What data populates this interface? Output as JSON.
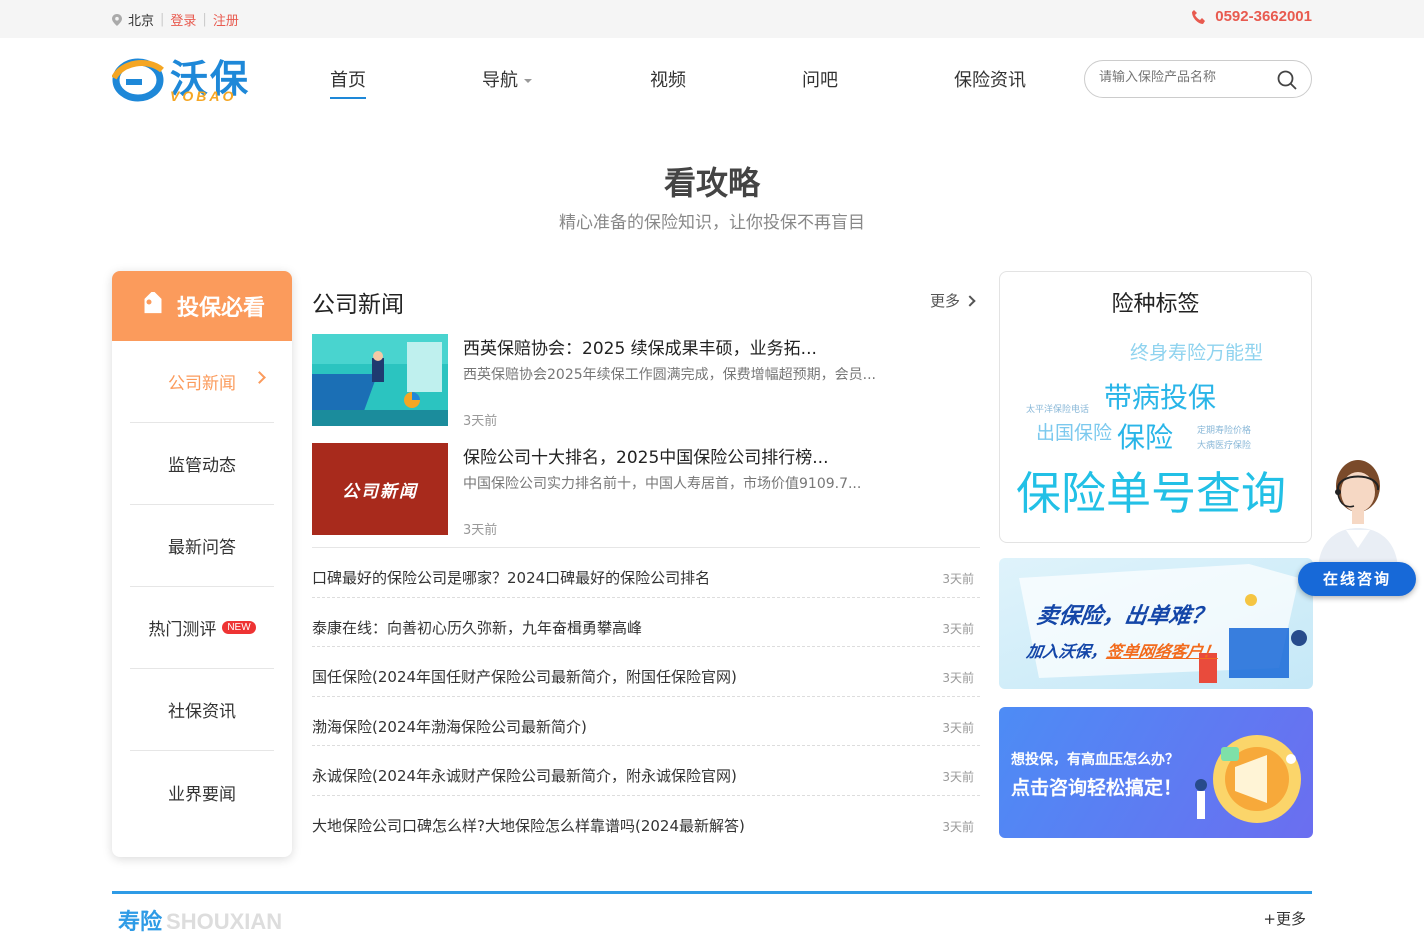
{
  "topbar": {
    "city": "北京",
    "login": "登录",
    "register": "注册",
    "phone": "0592-3662001"
  },
  "logo": {
    "cn": "沃保",
    "en": "VOBAO"
  },
  "nav": [
    {
      "label": "首页",
      "active": true
    },
    {
      "label": "导航"
    },
    {
      "label": "视频"
    },
    {
      "label": "问吧"
    },
    {
      "label": "保险资讯"
    }
  ],
  "search": {
    "placeholder": "请输入保险产品名称"
  },
  "section": {
    "title": "看攻略",
    "subtitle": "精心准备的保险知识，让你投保不再盲目"
  },
  "sidebar": {
    "head": "投保必看",
    "items": [
      {
        "label": "公司新闻"
      },
      {
        "label": "监管动态"
      },
      {
        "label": "最新问答"
      },
      {
        "label": "热门测评",
        "badge": "NEW"
      },
      {
        "label": "社保资讯"
      },
      {
        "label": "业界要闻"
      }
    ]
  },
  "news": {
    "heading": "公司新闻",
    "more": "更多",
    "featured": [
      {
        "title": "西英保赔协会：2025 续保成果丰硕，业务拓...",
        "desc": "西英保赔协会2025年续保工作圆满完成，保费增幅超预期，会员...",
        "time": "3天前"
      },
      {
        "title": "保险公司十大排名，2025中国保险公司排行榜...",
        "desc": "中国保险公司实力排名前十，中国人寿居首，市场价值9109.7...",
        "time": "3天前",
        "thumb_text": "公司新闻"
      }
    ],
    "list": [
      {
        "title": "口碑最好的保险公司是哪家？2024口碑最好的保险公司排名",
        "time": "3天前"
      },
      {
        "title": "泰康在线：向善初心历久弥新，九年奋楫勇攀高峰",
        "time": "3天前"
      },
      {
        "title": "国任保险(2024年国任财产保险公司最新简介，附国任保险官网)",
        "time": "3天前"
      },
      {
        "title": "渤海保险(2024年渤海保险公司最新简介)",
        "time": "3天前"
      },
      {
        "title": "永诚保险(2024年永诚财产保险公司最新简介，附永诚保险官网)",
        "time": "3天前"
      },
      {
        "title": "大地保险公司口碑怎么样?大地保险怎么样靠谱吗(2024最新解答)",
        "time": "3天前"
      }
    ]
  },
  "tags": {
    "heading": "险种标签",
    "items": [
      "终身寿险万能型",
      "带病投保",
      "太平洋保险电话",
      "出国保险",
      "保险",
      "定期寿险价格",
      "大病医疗保险",
      "保险单号查询"
    ]
  },
  "banners": {
    "b1": {
      "line1": "卖保险，出单难？",
      "line2a": "加入沃保，",
      "line2b": "签单网络客户！"
    },
    "b2": {
      "line1": "想投保，有高血压怎么办？",
      "line2": "点击咨询轻松搞定！"
    }
  },
  "consult": {
    "label": "在线咨询"
  },
  "bottom": {
    "title": "寿险",
    "title_en": "SHOUXIAN",
    "more": "+更多"
  },
  "colors": {
    "brand": "#1e88d8",
    "orange": "#fb9b5c",
    "red": "#e85a4f",
    "tag": "#29b5e8"
  }
}
